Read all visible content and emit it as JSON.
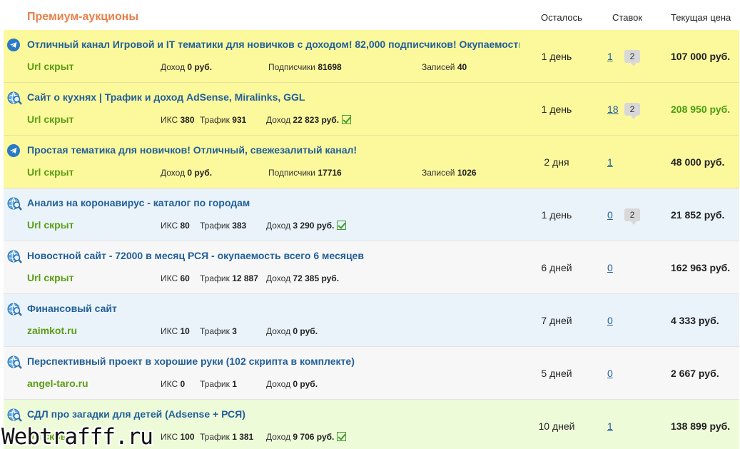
{
  "header": {
    "title": "Премиум-аукционы",
    "col_left": "Осталось",
    "col_bids": "Ставок",
    "col_price": "Текущая цена"
  },
  "rows": [
    {
      "icon": "telegram-icon",
      "bg": "yellow",
      "name": "Отличный канал Игровой и IT тематики для новичков с доходом! 82,000 подписчиков! Окупаемость",
      "url": "Url скрыт",
      "stats": [
        {
          "label": "Доход",
          "value": "0 руб."
        },
        {
          "label": "Подписчики",
          "value": "81698"
        },
        {
          "label": "Записей",
          "value": "40"
        }
      ],
      "left": "1 день",
      "bids": "1",
      "comments": "2",
      "price": "107 000 руб.",
      "price_green": false
    },
    {
      "icon": "site-search-icon",
      "bg": "yellow",
      "name": "Сайт о кухнях | Трафик и доход AdSense, Miralinks, GGL",
      "url": "Url скрыт",
      "stats": [
        {
          "label": "ИКС",
          "value": "380"
        },
        {
          "label": "Трафик",
          "value": "931"
        },
        {
          "label": "Доход",
          "value": "22 823 руб."
        }
      ],
      "verified": true,
      "left": "1 день",
      "bids": "18",
      "comments": "2",
      "price": "208 950 руб.",
      "price_green": true
    },
    {
      "icon": "telegram-icon",
      "bg": "yellow",
      "name": "Простая тематика для новичков! Отличный, свежезалитый канал!",
      "url": "Url скрыт",
      "stats": [
        {
          "label": "Доход",
          "value": "0 руб."
        },
        {
          "label": "Подписчики",
          "value": "17716"
        },
        {
          "label": "Записей",
          "value": "1026"
        }
      ],
      "left": "2 дня",
      "bids": "1",
      "comments": "",
      "price": "48 000 руб.",
      "price_green": false
    },
    {
      "icon": "site-search-icon",
      "bg": "blue",
      "name": "Анализ на коронавирус - каталог по городам",
      "url": "Url скрыт",
      "stats": [
        {
          "label": "ИКС",
          "value": "80"
        },
        {
          "label": "Трафик",
          "value": "383"
        },
        {
          "label": "Доход",
          "value": "3 290 руб."
        }
      ],
      "verified": true,
      "left": "1 день",
      "bids": "0",
      "comments": "2",
      "price": "21 852 руб.",
      "price_green": false
    },
    {
      "icon": "site-search-icon",
      "bg": "white",
      "name": "Новостной сайт - 72000 в месяц РСЯ - окупаемость всего 6 месяцев",
      "url": "Url скрыт",
      "stats": [
        {
          "label": "ИКС",
          "value": "60"
        },
        {
          "label": "Трафик",
          "value": "12 887"
        },
        {
          "label": "Доход",
          "value": "72 385 руб."
        }
      ],
      "left": "6 дней",
      "bids": "0",
      "comments": "",
      "price": "162 963 руб.",
      "price_green": false
    },
    {
      "icon": "site-search-icon",
      "bg": "blue2",
      "name": "Финансовый сайт",
      "url": "zaimkot.ru",
      "stats": [
        {
          "label": "ИКС",
          "value": "10"
        },
        {
          "label": "Трафик",
          "value": "3"
        },
        {
          "label": "Доход",
          "value": "0 руб."
        }
      ],
      "left": "7 дней",
      "bids": "0",
      "comments": "",
      "price": "4 333 руб.",
      "price_green": false
    },
    {
      "icon": "site-search-icon",
      "bg": "white",
      "name": "Перспективный проект в хорошие руки (102 скрипта в комплекте)",
      "url": "angel-taro.ru",
      "stats": [
        {
          "label": "ИКС",
          "value": "0"
        },
        {
          "label": "Трафик",
          "value": "1"
        },
        {
          "label": "Доход",
          "value": "0 руб."
        }
      ],
      "left": "5 дней",
      "bids": "0",
      "comments": "",
      "price": "2 667 руб.",
      "price_green": false
    },
    {
      "icon": "site-search-icon",
      "bg": "green",
      "name": "СДЛ про загадки для детей (Adsense + РСЯ)",
      "url": "Url скрыт",
      "stats": [
        {
          "label": "ИКС",
          "value": "100"
        },
        {
          "label": "Трафик",
          "value": "1 381"
        },
        {
          "label": "Доход",
          "value": "9 706 руб."
        }
      ],
      "verified": true,
      "left": "10 дней",
      "bids": "1",
      "comments": "",
      "price": "138 899 руб.",
      "price_green": false
    }
  ],
  "watermark": "Webtrafff.ru",
  "colors": {
    "accent": "#e8804a",
    "link": "#22609a",
    "url_green": "#5a9e13",
    "premium_bg": "#fcf89c"
  }
}
